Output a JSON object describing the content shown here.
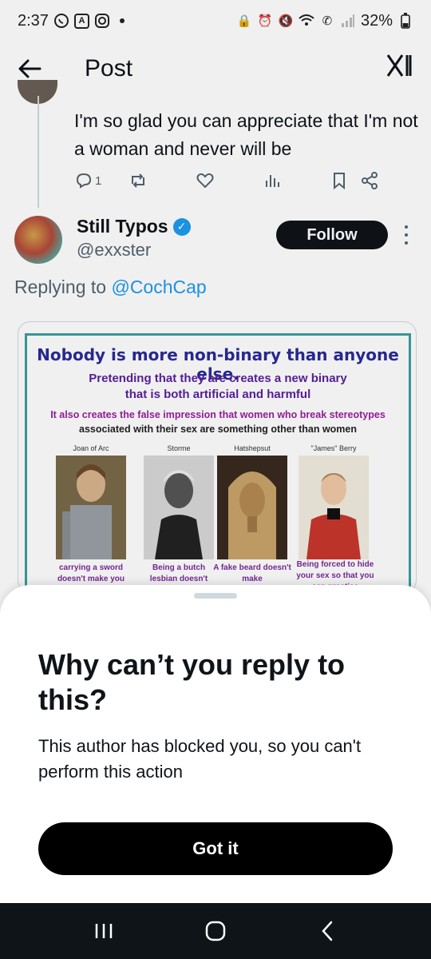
{
  "status_bar": {
    "time": "2:37",
    "battery": "32%"
  },
  "header": {
    "title": "Post",
    "logo_text": "X",
    "back_icon": "arrow-left-icon"
  },
  "parent_tweet": {
    "text": "I'm so glad you can appreciate that I'm not a woman and never will be",
    "reply_count": "1"
  },
  "reply_tweet": {
    "display_name": "Still Typos",
    "handle": "@exxster",
    "follow_label": "Follow",
    "replying_prefix": "Replying to",
    "replying_mention": "@CochCap"
  },
  "media": {
    "title": "Nobody is more non-binary than anyone else.",
    "subtitle_line1": "Pretending that they are creates a new binary",
    "subtitle_line2": "that is both artificial and harmful",
    "line3": "It also creates the false impression that women who break stereotypes",
    "line4": "associated with their sex are something other than women",
    "portraits": [
      {
        "label": "Joan of Arc",
        "caption": "carrying a sword doesn't make you"
      },
      {
        "label": "Storme",
        "caption": "Being a butch lesbian doesn't"
      },
      {
        "label": "Hatshepsut",
        "caption": "A fake beard doesn't make"
      },
      {
        "label": "\"James\" Berry",
        "caption": "Being forced to hide your sex so that you can practice medicine"
      }
    ]
  },
  "sheet": {
    "title": "Why can’t you reply to this?",
    "body": "This author has blocked you, so you can't perform this action",
    "button_label": "Got it"
  },
  "colors": {
    "accent": "#1d9bf0",
    "text": "#0f1419",
    "muted": "#536471",
    "button": "#000000"
  }
}
